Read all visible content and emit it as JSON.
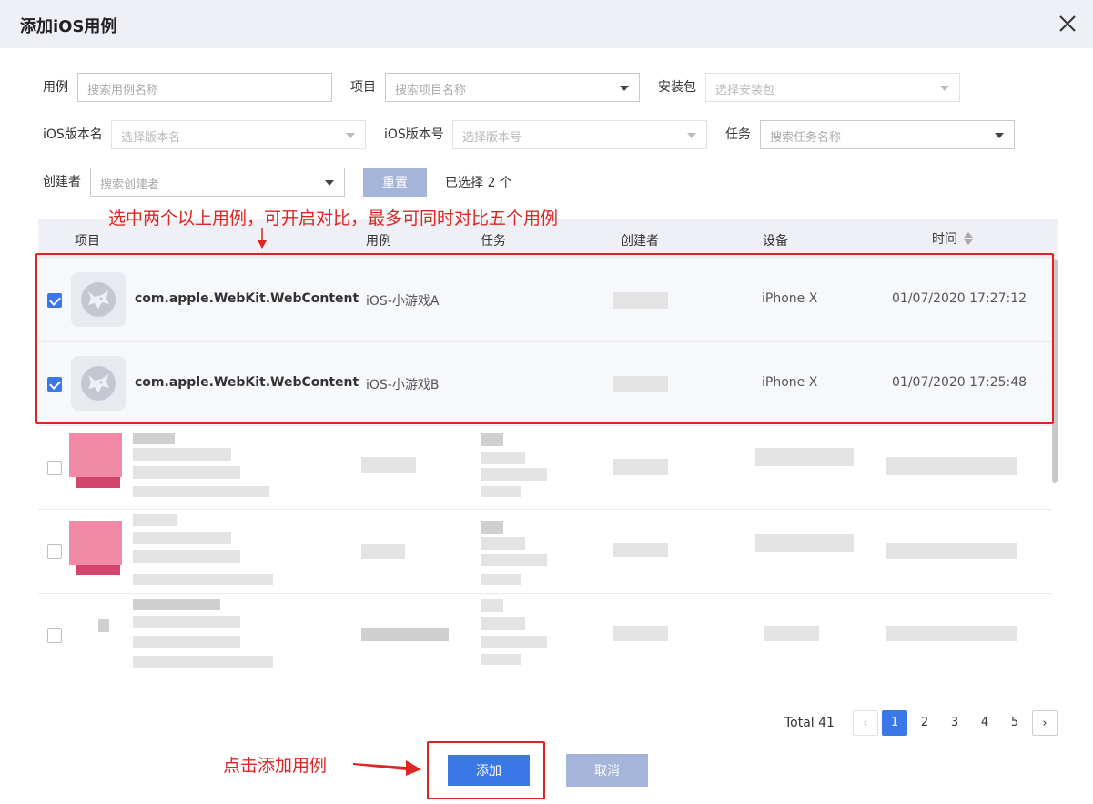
{
  "dialog": {
    "title": "添加iOS用例"
  },
  "filters": {
    "case_label": "用例",
    "case_placeholder": "搜索用例名称",
    "project_label": "项目",
    "project_placeholder": "搜索项目名称",
    "package_label": "安装包",
    "package_placeholder": "选择安装包",
    "ios_version_name_label": "iOS版本名",
    "ios_version_name_placeholder": "选择版本名",
    "ios_version_no_label": "iOS版本号",
    "ios_version_no_placeholder": "选择版本号",
    "task_label": "任务",
    "task_placeholder": "搜索任务名称",
    "creator_label": "创建者",
    "creator_placeholder": "搜索创建者",
    "reset_label": "重置",
    "selected_text": "已选择 2 个"
  },
  "table": {
    "headers": {
      "project": "项目",
      "case": "用例",
      "task": "任务",
      "creator": "创建者",
      "device": "设备",
      "time": "时间"
    },
    "rows": [
      {
        "project": "com.apple.WebKit.WebContent",
        "case": "iOS-小游戏A",
        "device": "iPhone X",
        "time": "01/07/2020 17:27:12",
        "checked": true
      },
      {
        "project": "com.apple.WebKit.WebContent",
        "case": "iOS-小游戏B",
        "device": "iPhone X",
        "time": "01/07/2020 17:25:48",
        "checked": true
      }
    ]
  },
  "annotations": {
    "compare_hint": "选中两个以上用例，可开启对比，最多可同时对比五个用例",
    "add_hint": "点击添加用例"
  },
  "pagination": {
    "total": "Total 41",
    "pages": [
      "1",
      "2",
      "3",
      "4",
      "5"
    ],
    "current": "1"
  },
  "footer": {
    "add_label": "添加",
    "cancel_label": "取消"
  },
  "colors": {
    "primary": "#3a78e7",
    "disabled_button": "#a5b4d9",
    "annotation_red": "#e02424",
    "header_bg": "#eef0f6"
  },
  "icons": {
    "close": "close-icon",
    "app": "wolf-icon",
    "dropdown": "caret-down-icon",
    "sort": "sort-icon"
  }
}
